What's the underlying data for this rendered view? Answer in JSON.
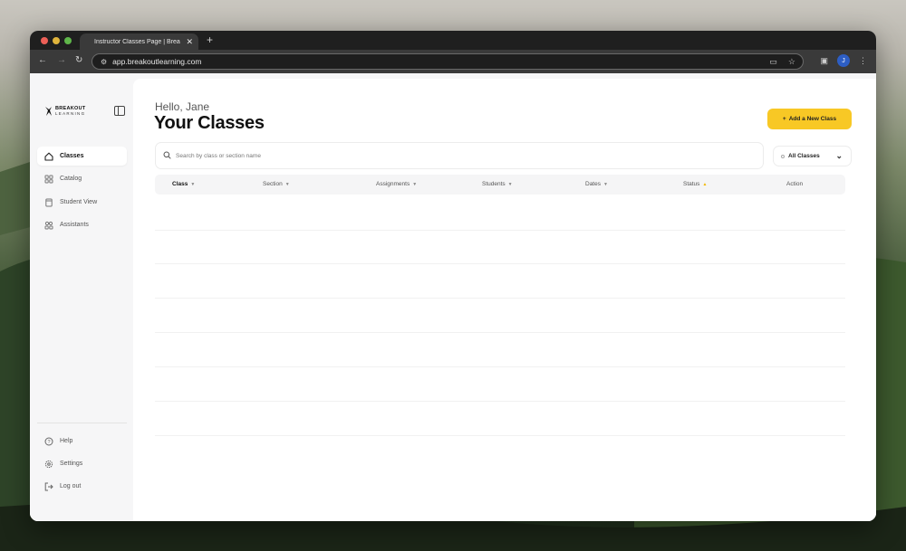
{
  "browser": {
    "tab_title": "Instructor Classes Page | Brea",
    "tab_close": "✕",
    "new_tab": "+",
    "url": "app.breakoutlearning.com",
    "profile_initial": "J"
  },
  "sidebar": {
    "logo_text": "BREAKOUT",
    "logo_sub": "LEARNING",
    "items": [
      {
        "label": "Classes",
        "icon": "house-icon",
        "active": true
      },
      {
        "label": "Catalog",
        "icon": "grid-icon",
        "active": false
      },
      {
        "label": "Student View",
        "icon": "document-icon",
        "active": false
      },
      {
        "label": "Assistants",
        "icon": "people-icon",
        "active": false
      }
    ],
    "bottom_items": [
      {
        "label": "Help",
        "icon": "help-icon"
      },
      {
        "label": "Settings",
        "icon": "gear-icon"
      },
      {
        "label": "Log out",
        "icon": "logout-icon"
      }
    ]
  },
  "main": {
    "greeting": "Hello, Jane",
    "title": "Your Classes",
    "add_button": "Add a New Class",
    "add_icon": "+",
    "search_placeholder": "Search by class or section name",
    "filter_label": "All Classes",
    "columns": [
      {
        "label": "Class",
        "bold": true
      },
      {
        "label": "Section"
      },
      {
        "label": "Assignments"
      },
      {
        "label": "Students"
      },
      {
        "label": "Dates"
      },
      {
        "label": "Status",
        "active_sort": true
      },
      {
        "label": "Action"
      }
    ]
  },
  "colors": {
    "accent": "#f8c825"
  }
}
